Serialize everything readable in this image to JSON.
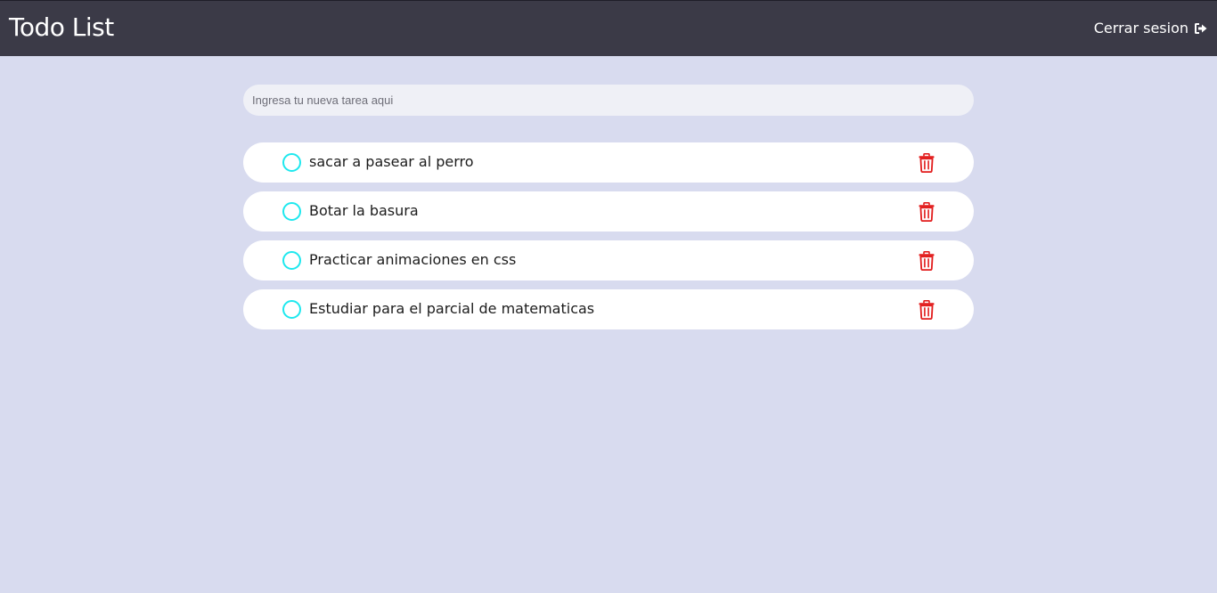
{
  "header": {
    "title": "Todo List",
    "logout_label": "Cerrar sesion",
    "logout_icon": "sign-out-icon"
  },
  "new_task": {
    "value": "",
    "placeholder": "Ingresa tu nueva tarea aqui"
  },
  "tasks": [
    {
      "text": "sacar a pasear al perro",
      "completed": false
    },
    {
      "text": "Botar la basura",
      "completed": false
    },
    {
      "text": "Practicar animaciones en css",
      "completed": false
    },
    {
      "text": "Estudiar para el parcial de matematicas",
      "completed": false
    }
  ],
  "icons": {
    "check": "circle-check-icon",
    "delete": "trash-icon"
  },
  "colors": {
    "header_bg": "#3b3a47",
    "page_bg": "#d8dbef",
    "check_accent": "#1ee8ee",
    "delete_red": "#e21b1b"
  }
}
